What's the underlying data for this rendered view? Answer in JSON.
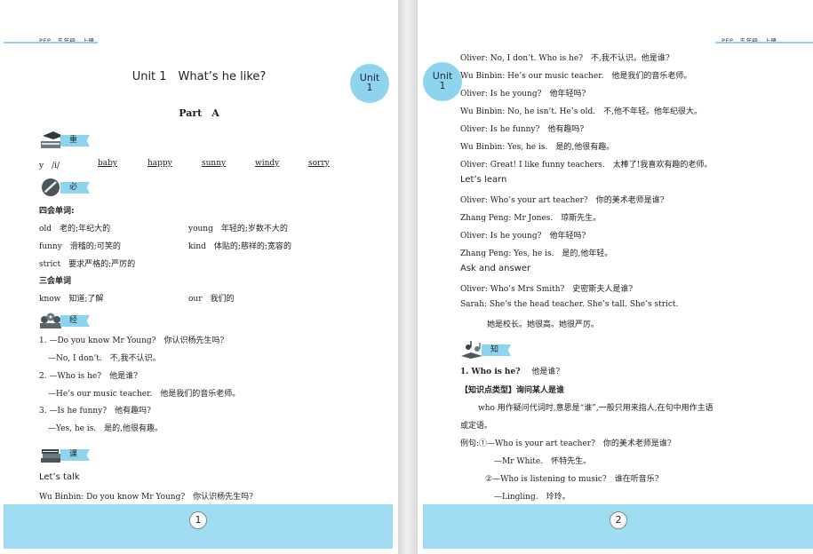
{
  "header": {
    "label": "PEP　五年级　上册"
  },
  "unit_badge": {
    "line1": "Unit",
    "line2": "1"
  },
  "left": {
    "title": "Unit 1　What’s he like?",
    "part": "Part　A",
    "sections": {
      "pronunciation": "重点语音",
      "vocab": "必会词汇",
      "sentences": "经典句型",
      "translation": "课文翻译"
    },
    "sounds": [
      "y　/i/",
      "baby",
      "happy",
      "sunny",
      "windy",
      "sorry"
    ],
    "four_skills_label": "四会单词:",
    "vocab_rows": [
      {
        "a": "old　老的;年纪大的",
        "b": "young　年轻的;岁数不大的"
      },
      {
        "a": "funny　滑稽的;可笑的",
        "b": "kind　体贴的;慈祥的;宽容的"
      },
      {
        "a": "strict　要求严格的;严厉的",
        "b": ""
      }
    ],
    "three_skills_label": "三会单词",
    "three_row": {
      "a": "know　知道;了解",
      "b": "our　我们的"
    },
    "sentences": [
      "1. —Do you know Mr Young?　你认识杨先生吗?",
      "—No, I don’t.　不,我不认识。",
      "2. —Who is he?　他是谁?",
      "—He’s our music teacher.　他是我们的音乐老师。",
      "3. —Is he funny?　他有趣吗?",
      "—Yes, he is.　是的,他很有趣。"
    ],
    "lets_talk": "Let’s talk",
    "talk_line": "Wu Binbin: Do you know Mr Young?　你认识杨先生吗?",
    "page_number": "1"
  },
  "right": {
    "dialog1": [
      "Oliver: No, I don’t. Who is he?　不,我不认识。他是谁?",
      "Wu Binbin: He’s our music teacher.　他是我们的音乐老师。",
      "Oliver: Is he young?　他年轻吗?",
      "Wu Binbin: No, he isn’t. He’s old.　不,他不年轻。他年纪很大。",
      "Oliver: Is he funny?　他有趣吗?",
      "Wu Binbin: Yes, he is.　是的,他很有趣。",
      "Oliver: Great! I like funny teachers.　太棒了!我喜欢有趣的老师。"
    ],
    "lets_learn": "Let’s learn",
    "dialog2": [
      "Oliver: Who’s your art teacher?　你的美术老师是谁?",
      "Zhang Peng: Mr Jones.　琼斯先生。",
      "Oliver: Is he young?　他年轻吗?",
      "Zhang Peng: Yes, he is.　是的,他年轻。"
    ],
    "ask_answer": "Ask and answer",
    "dialog3": [
      "Oliver: Who’s Mrs Smith?　史密斯夫人是谁?",
      "Sarah: She’s the head teacher. She’s tall. She’s strict.",
      "她是校长。她很高。她很严厉。"
    ],
    "knowledge_section": "知识点拨",
    "point1_title": "1. Who is he?",
    "point1_cn": "他是谁?",
    "point1_type": "【知识点类型】询问某人是谁",
    "point1_desc1": "who 用作疑问代词时,意思是“谁”,一般只用来指人,在句中用作主语",
    "point1_desc2": "或定语。",
    "examples": [
      "例句:①—Who is your art teacher?　你的美术老师是谁?",
      "—Mr White.　怀特先生。",
      "②—Who is listening to music?　谁在听音乐?",
      "—Lingling.　玲玲。"
    ],
    "page_number": "2"
  },
  "colors": {
    "accent": "#8fd4ef",
    "footer": "#9fdcf2"
  }
}
